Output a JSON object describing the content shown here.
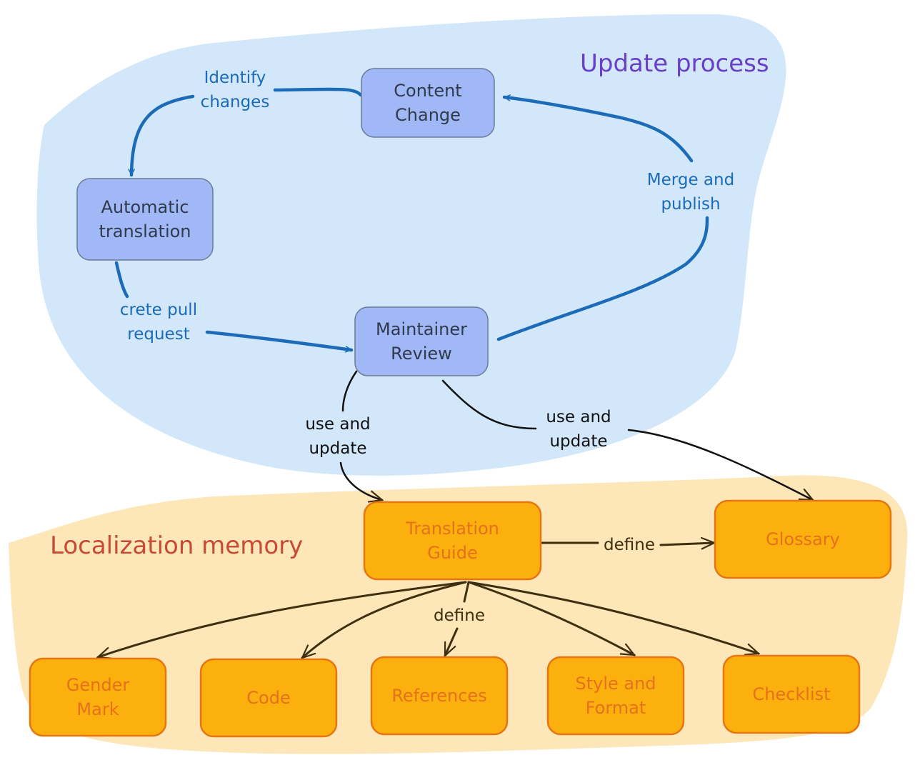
{
  "colors": {
    "update_region_fill": "#d3e7fa",
    "memory_region_fill": "#fde6b8",
    "blue_node_fill": "#a0b8f5",
    "blue_node_stroke": "#6b7a99",
    "blue_node_text": "#2f3a4d",
    "blue_edge": "#1c6bb8",
    "orange_node_fill": "#fbb00e",
    "orange_node_stroke": "#e67512",
    "orange_node_text": "#e6711b",
    "dark_edge": "#3d2f0f",
    "black_edge": "#111111",
    "update_title": "#6a3fc8",
    "memory_title": "#c84a35"
  },
  "regions": {
    "update": {
      "title": "Update process"
    },
    "memory": {
      "title": "Localization memory"
    }
  },
  "nodes": {
    "content_change": {
      "lines": [
        "Content",
        "Change"
      ]
    },
    "automatic_translation": {
      "lines": [
        "Automatic",
        "translation"
      ]
    },
    "maintainer_review": {
      "lines": [
        "Maintainer",
        "Review"
      ]
    },
    "translation_guide": {
      "lines": [
        "Translation",
        "Guide"
      ]
    },
    "glossary": {
      "lines": [
        "Glossary"
      ]
    },
    "gender_mark": {
      "lines": [
        "Gender",
        "Mark"
      ]
    },
    "code": {
      "lines": [
        "Code"
      ]
    },
    "references": {
      "lines": [
        "References"
      ]
    },
    "style_format": {
      "lines": [
        "Style and",
        "Format"
      ]
    },
    "checklist": {
      "lines": [
        "Checklist"
      ]
    }
  },
  "edges": {
    "identify_changes": {
      "lines": [
        "Identify",
        "changes"
      ]
    },
    "create_pull_request": {
      "lines": [
        "crete pull",
        "request"
      ]
    },
    "merge_publish": {
      "lines": [
        "Merge and",
        "publish"
      ]
    },
    "use_update_guide": {
      "lines": [
        "use and",
        "update"
      ]
    },
    "use_update_glossary": {
      "lines": [
        "use and",
        "update"
      ]
    },
    "define_glossary": {
      "lines": [
        "define"
      ]
    },
    "define_children": {
      "lines": [
        "define"
      ]
    }
  }
}
